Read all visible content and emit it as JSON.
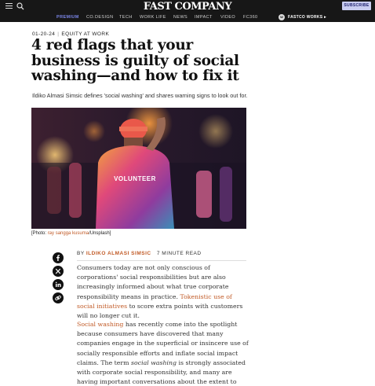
{
  "header": {
    "logo": "FAST COMPANY",
    "subscribe_label": "SUBSCRIBE",
    "nav": [
      "PREMIUM",
      "CO.DESIGN",
      "TECH",
      "WORK LIFE",
      "NEWS",
      "IMPACT",
      "VIDEO",
      "FC360"
    ],
    "works_badge": "W",
    "works_label": "FASTCO WORKS ▸",
    "colors": {
      "bar": "#171717",
      "active_nav": "#7b86e8",
      "subscribe_bg": "#c9cdf0"
    }
  },
  "article": {
    "date": "01-20-24",
    "section": "EQUITY AT WORK",
    "headline": "4 red flags that your business is guilty of social washing—and how to fix it",
    "dek": "Ildiko Almasi Simsic defines 'social washing' and shares warning signs to look out for.",
    "hero_shirt_text": "VOLUNTEER",
    "caption": {
      "prefix": "[Photo: ",
      "credit": "ray sangga kusuma",
      "suffix": "/Unsplash]"
    },
    "byline": {
      "by": "BY",
      "author": "ILDIKO ALMASI SIMSIC",
      "read_time": "7 MINUTE READ"
    },
    "share_icons": [
      "facebook-icon",
      "x-icon",
      "linkedin-icon",
      "link-icon"
    ],
    "paragraph1": {
      "text": "Consumers today are not only conscious of corporations' social responsibilities but are also increasingly informed about what true corporate responsibility means in practice.",
      "link": "Tokenistic use of social initiatives",
      "tail": " to score extra points with customers will no longer cut it."
    },
    "paragraph2": {
      "link": "Social washing",
      "text_a": " has recently come into the spotlight because consumers have discovered that many companies engage in the superficial or insincere use of socially responsible efforts and inflate social impact claims. The term ",
      "italic": "social washing",
      "text_b": " is strongly associated with corporate social responsibility, and many are having important conversations about the extent to which companies should"
    },
    "colors": {
      "link": "#c15a26",
      "body_text": "#333333"
    }
  }
}
